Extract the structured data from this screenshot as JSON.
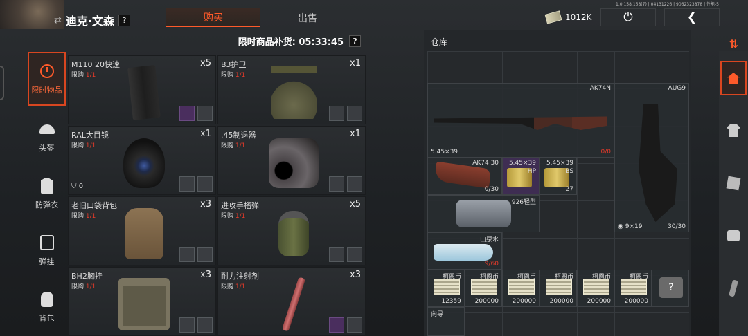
{
  "header": {
    "player_name": "迪克·文森",
    "swap_icon": "⇄",
    "help": "?",
    "tabs": [
      {
        "label": "购买",
        "active": true
      },
      {
        "label": "出售",
        "active": false
      }
    ],
    "version": "1.0.158.158(7) | 04131226 | 9062323878 | 性能-5",
    "money": "1012K"
  },
  "shop": {
    "restock_label": "限时商品补货: 05:33:45",
    "help": "?",
    "categories": [
      {
        "label": "限时物品",
        "icon": "clock-icon",
        "active": true
      },
      {
        "label": "头盔",
        "icon": "helmet-icon"
      },
      {
        "label": "防弹衣",
        "icon": "vest-icon"
      },
      {
        "label": "弹挂",
        "icon": "chest-rig-icon"
      },
      {
        "label": "背包",
        "icon": "backpack-icon"
      }
    ],
    "limit_prefix": "限购",
    "limit_value": "1/1",
    "items": [
      {
        "name": "M110 20快速",
        "qty": "x5",
        "shape": "mag"
      },
      {
        "name": "B3护卫",
        "qty": "x1",
        "shape": "chest"
      },
      {
        "name": "RAL大目镜",
        "qty": "x1",
        "shape": "gasmask",
        "armor": "0"
      },
      {
        "name": ".45制退器",
        "qty": "x1",
        "shape": "brake"
      },
      {
        "name": "老旧口袋背包",
        "qty": "x3",
        "shape": "backpack"
      },
      {
        "name": "进攻手榴弹",
        "qty": "x5",
        "shape": "grenade"
      },
      {
        "name": "BH2胸挂",
        "qty": "x3",
        "shape": "chestrig"
      },
      {
        "name": "耐力注射剂",
        "qty": "x3",
        "shape": "injector"
      }
    ]
  },
  "warehouse": {
    "title": "仓库",
    "ak74n": {
      "name": "AK74N",
      "ammo": "5.45×39",
      "durability": "0/0"
    },
    "aug9": {
      "name": "AUG9",
      "ammo": "9×19",
      "durability": "30/30"
    },
    "ak74mag": {
      "name": "AK74 30",
      "count": "0/30"
    },
    "ammo_hp": {
      "name": "5.45×39",
      "type": "HP"
    },
    "ammo_bs": {
      "name": "5.45×39",
      "type": "BS",
      "count": "27"
    },
    "tarp": {
      "name": "926轻型"
    },
    "water": {
      "name": "山泉水",
      "count": "9/60"
    },
    "cash": [
      {
        "name": "柯恩币",
        "count": "12359"
      },
      {
        "name": "柯恩币",
        "count": "200000"
      },
      {
        "name": "柯恩币",
        "count": "200000"
      },
      {
        "name": "柯恩币",
        "count": "200000"
      },
      {
        "name": "柯恩币",
        "count": "200000"
      },
      {
        "name": "柯恩币",
        "count": "200000"
      }
    ],
    "last_item": {
      "name": "向导"
    }
  },
  "colors": {
    "accent": "#ff5a2a",
    "limit_red": "#e53a2a",
    "panel": "#2b2e31"
  }
}
